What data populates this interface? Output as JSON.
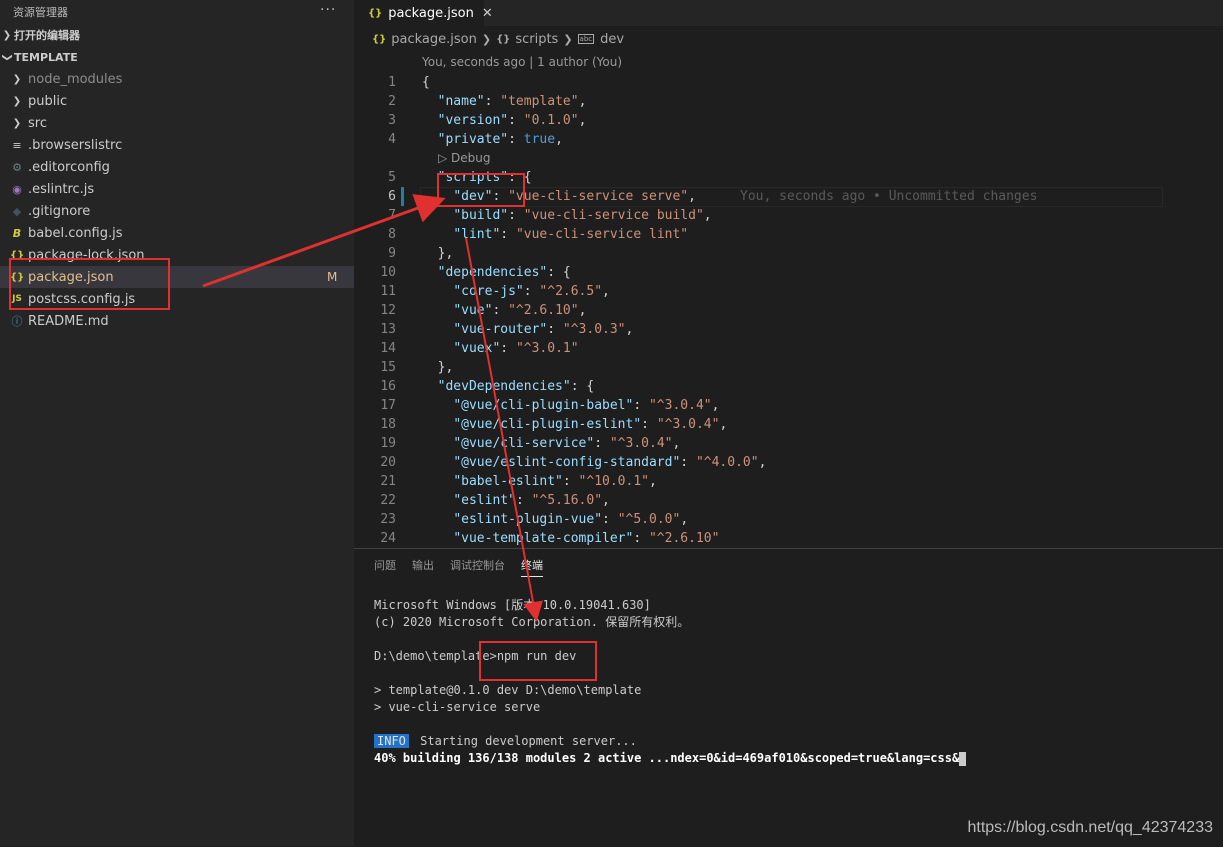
{
  "sidebar": {
    "title": "资源管理器",
    "more": "···",
    "open_editors": "打开的编辑器",
    "project": "TEMPLATE",
    "items": [
      {
        "label": "node_modules",
        "icon": "chevron-right-icon",
        "dim": true
      },
      {
        "label": "public",
        "icon": "chevron-right-icon"
      },
      {
        "label": "src",
        "icon": "chevron-right-icon"
      },
      {
        "label": ".browserslistrc",
        "icon": "lines-icon"
      },
      {
        "label": ".editorconfig",
        "icon": "gear-icon"
      },
      {
        "label": ".eslintrc.js",
        "icon": "eslint-icon"
      },
      {
        "label": ".gitignore",
        "icon": "git-icon"
      },
      {
        "label": "babel.config.js",
        "icon": "babel-icon"
      },
      {
        "label": "package-lock.json",
        "icon": "json-icon"
      },
      {
        "label": "package.json",
        "icon": "json-icon",
        "badge": "M"
      },
      {
        "label": "postcss.config.js",
        "icon": "js-icon"
      },
      {
        "label": "README.md",
        "icon": "info-icon"
      }
    ]
  },
  "editor": {
    "tab_label": "package.json",
    "breadcrumb": [
      "package.json",
      "scripts",
      "dev"
    ],
    "codelens_top": "You, seconds ago | 1 author (You)",
    "codelens_debug": "Debug",
    "blame": "You, seconds ago • Uncommitted changes",
    "lines": [
      "1",
      "2",
      "3",
      "4",
      "5",
      "6",
      "7",
      "8",
      "9",
      "10",
      "11",
      "12",
      "13",
      "14",
      "15",
      "16",
      "17",
      "18",
      "19",
      "20",
      "21",
      "22",
      "23",
      "24"
    ]
  },
  "panel": {
    "tabs": [
      "问题",
      "输出",
      "调试控制台",
      "终端"
    ],
    "active_tab": "终端",
    "terminal": [
      "Microsoft Windows [版本 10.0.19041.630]",
      "(c) 2020 Microsoft Corporation. 保留所有权利。",
      "",
      "D:\\demo\\template>npm run dev",
      "",
      "> template@0.1.0 dev D:\\demo\\template",
      "> vue-cli-service serve",
      ""
    ],
    "info_badge": "INFO",
    "info_text": " Starting development server...",
    "progress": "40% building 136/138 modules 2 active ...ndex=0&id=469af010&scoped=true&lang=css&"
  },
  "watermark": "https://blog.csdn.net/qq_42374233",
  "colors": {
    "annotation": "#e0302f",
    "accent": "#2472c8"
  }
}
